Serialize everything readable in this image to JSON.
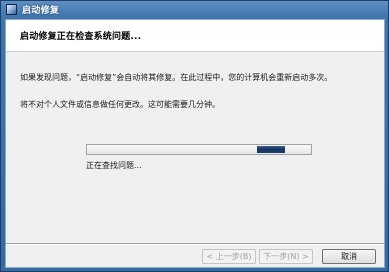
{
  "window": {
    "title": "启动修复"
  },
  "header": {
    "heading": "启动修复正在检查系统问题..."
  },
  "body": {
    "message1": "如果发现问题，“启动修复”会自动将其修复。在此过程中，您的计算机会重新启动多次。",
    "message2": "将不对个人文件或信息做任何更改。这可能需要几分钟。",
    "status": "正在查找问题..."
  },
  "buttons": {
    "back": "< 上一步(B)",
    "next": "下一步(N) >",
    "cancel": "取消"
  },
  "colors": {
    "titlebar": "#356aa3",
    "progress_fill": "#1e416f",
    "dialog_background": "#f0f0f0"
  },
  "icons": {
    "app": "startup-repair-icon"
  }
}
